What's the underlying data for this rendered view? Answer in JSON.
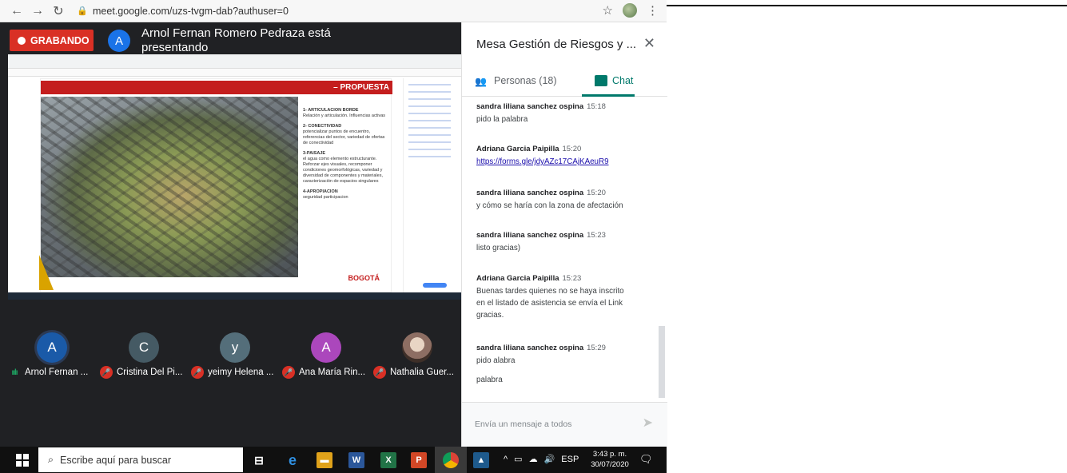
{
  "browser": {
    "url": "meet.google.com/uzs-tvgm-dab?authuser=0"
  },
  "meeting": {
    "recording_label": "GRABANDO",
    "presenter_initial": "A",
    "presenter_text": "Arnol Fernan Romero Pedraza está presentando"
  },
  "shared_slide": {
    "banner": "– PROPUESTA",
    "logo": "BOGOTÁ",
    "points": [
      {
        "title": "1- ARTICULACION BORDE",
        "text": "Relación y articulación. Influencias activas"
      },
      {
        "title": "2- CONECTIVIDAD",
        "text": "potencializar puntos de encuentro, referencias del sector, variedad de ofertas de conectividad"
      },
      {
        "title": "3-PAISAJE",
        "text": "el agua como elemento estructurante. Reforzar ejes visuales, recomponer condiciones geomorfológicas, variedad y diversidad de componentes y materiales, caracterización de espacios singulares"
      },
      {
        "title": "4-APROPIACION",
        "text": "seguridad participacion"
      }
    ]
  },
  "participants": [
    {
      "initial": "A",
      "color": "#1a5aa8",
      "name": "Arnol Fernan ...",
      "muted": false
    },
    {
      "initial": "C",
      "color": "#455a64",
      "name": "Cristina Del Pi...",
      "muted": true
    },
    {
      "initial": "y",
      "color": "#546e7a",
      "name": "yeimy Helena ...",
      "muted": true
    },
    {
      "initial": "A",
      "color": "#ab47bc",
      "name": "Ana María Rin...",
      "muted": true
    },
    {
      "initial": "",
      "color": "#8d6e63",
      "name": "Nathalia Guer...",
      "muted": true
    }
  ],
  "panel": {
    "title": "Mesa Gestión de Riesgos y ...",
    "tab_people": "Personas (18)",
    "tab_chat": "Chat",
    "input_placeholder": "Envía un mensaje a todos"
  },
  "messages": [
    {
      "sender": "sandra liliana sanchez ospina",
      "time": "15:18",
      "lines": [
        "pido la palabra"
      ]
    },
    {
      "sender": "Adriana Garcia Paipilla",
      "time": "15:20",
      "link": "https://forms.gle/jdyAZc17CAjKAeuR9"
    },
    {
      "sender": "sandra liliana sanchez ospina",
      "time": "15:20",
      "lines": [
        "y cómo se haría con la zona de afectación"
      ]
    },
    {
      "sender": "sandra liliana sanchez ospina",
      "time": "15:23",
      "lines": [
        "listo gracias)"
      ]
    },
    {
      "sender": "Adriana Garcia Paipilla",
      "time": "15:23",
      "lines": [
        "Buenas tardes quienes no se haya inscrito",
        "en el  listado de asistencia se envía el Link",
        "gracias."
      ]
    },
    {
      "sender": "sandra liliana sanchez ospina",
      "time": "15:29",
      "lines": [
        "pido alabra",
        "",
        "palabra"
      ]
    }
  ],
  "taskbar": {
    "search_placeholder": "Escribe aquí para buscar",
    "lang": "ESP",
    "time": "3:43 p. m.",
    "date": "30/07/2020"
  }
}
